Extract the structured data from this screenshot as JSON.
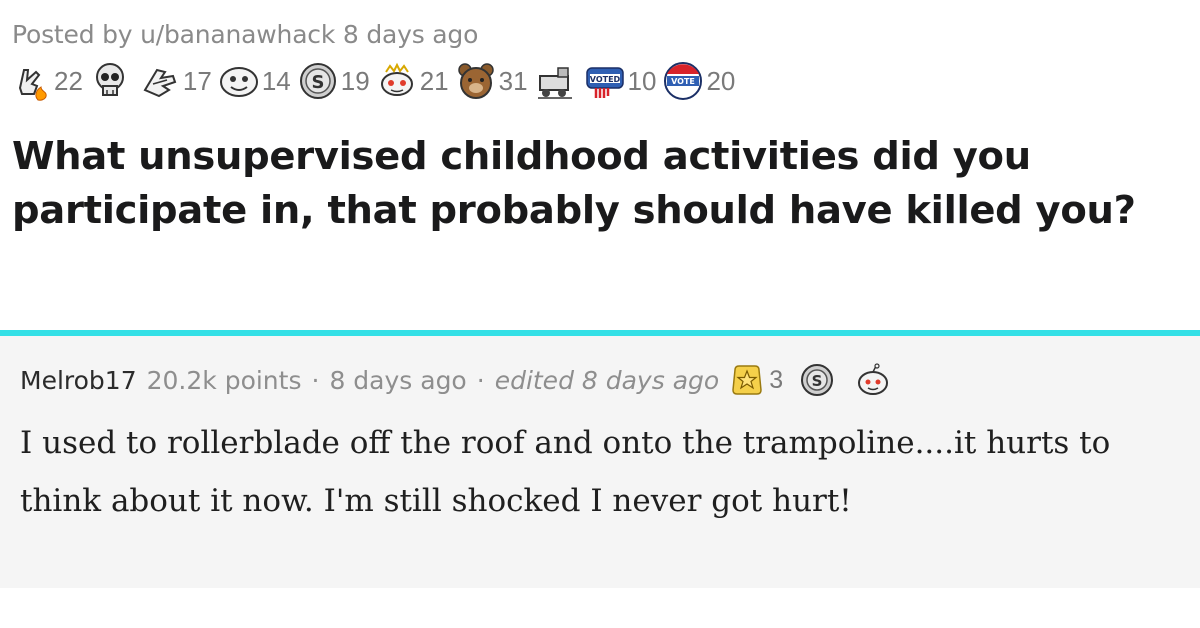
{
  "post": {
    "meta": "Posted by u/bananawhack 8 days ago",
    "title": "What unsupervised childhood activities did you participate in, that probably should have killed you?",
    "awards": [
      {
        "icon": "hand-flame-icon",
        "count": "22"
      },
      {
        "icon": "skull-icon",
        "count": ""
      },
      {
        "icon": "hug-hand-icon",
        "count": "17"
      },
      {
        "icon": "silly-face-icon",
        "count": "14"
      },
      {
        "icon": "silver-coin-icon",
        "count": "19"
      },
      {
        "icon": "snoo-icon",
        "count": "21"
      },
      {
        "icon": "bear-icon",
        "count": "31"
      },
      {
        "icon": "train-icon",
        "count": ""
      },
      {
        "icon": "voted-badge-icon",
        "count": "10"
      },
      {
        "icon": "vote-button-icon",
        "count": "20"
      }
    ]
  },
  "comment": {
    "author": "Melrob17",
    "points": "20.2k points",
    "separator": "·",
    "time": "8 days ago",
    "edited": "edited 8 days ago",
    "awards": [
      {
        "icon": "gold-star-icon",
        "count": "3"
      },
      {
        "icon": "silver-coin-icon",
        "count": ""
      },
      {
        "icon": "snoo-face-icon",
        "count": ""
      }
    ],
    "body": "I used to rollerblade off the roof and onto the trampoline....it hurts to think about it now. I'm still shocked I never got hurt!"
  },
  "colors": {
    "accent": "#34e0e6",
    "comment_bg": "#f5f5f5",
    "muted_text": "#8a8a8a"
  }
}
